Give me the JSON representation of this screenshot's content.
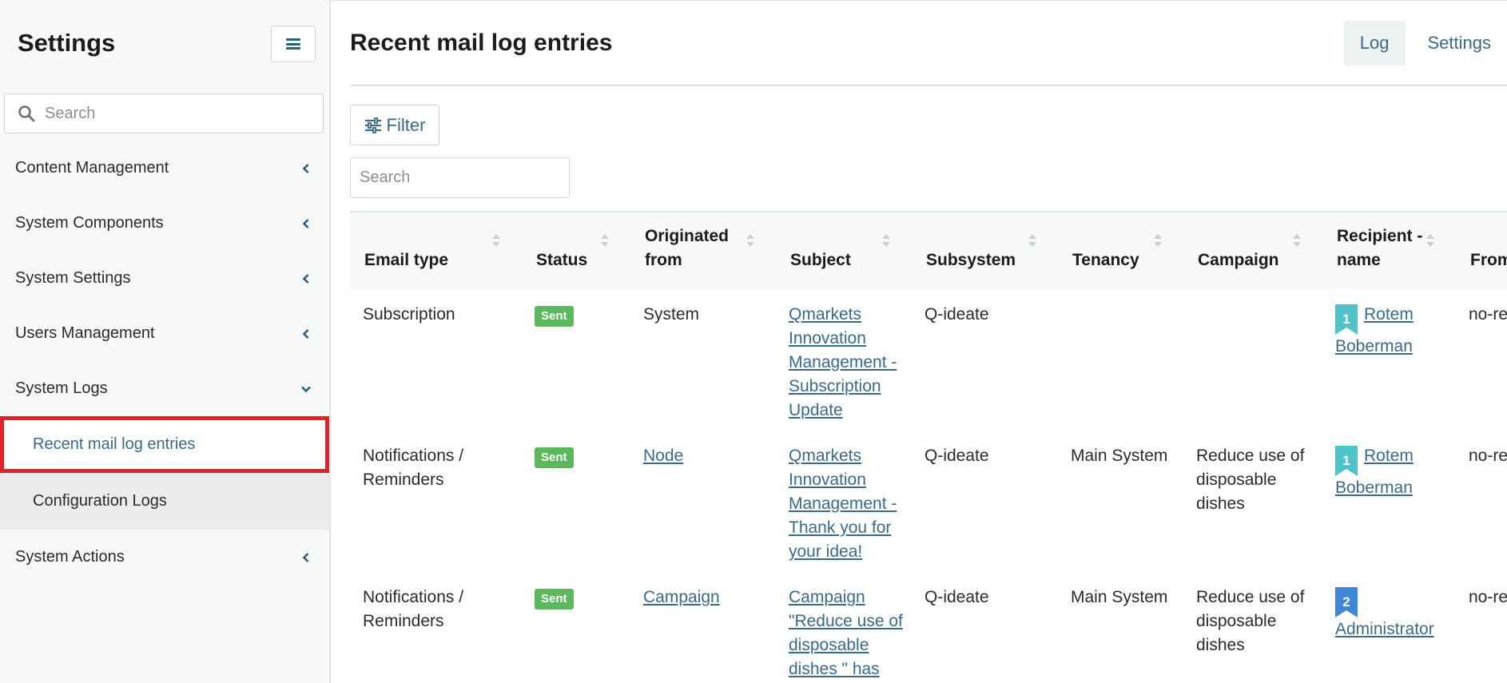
{
  "sidebar": {
    "title": "Settings",
    "search_placeholder": "Search",
    "items": [
      {
        "label": "Content Management"
      },
      {
        "label": "System Components"
      },
      {
        "label": "System Settings"
      },
      {
        "label": "Users Management"
      },
      {
        "label": "System Logs",
        "expanded": true,
        "children": [
          {
            "label": "Recent mail log entries",
            "active": true
          },
          {
            "label": "Configuration Logs"
          }
        ]
      },
      {
        "label": "System Actions"
      }
    ]
  },
  "header": {
    "title": "Recent mail log entries",
    "tabs": [
      {
        "label": "Log",
        "active": true
      },
      {
        "label": "Settings"
      }
    ]
  },
  "toolbar": {
    "filter_label": "Filter",
    "search_placeholder": "Search"
  },
  "table": {
    "columns": [
      "Email type",
      "Status",
      "Originated from",
      "Subject",
      "Subsystem",
      "Tenancy",
      "Campaign",
      "Recipient - name",
      "From email"
    ],
    "rows": [
      {
        "email_type": "Subscription",
        "status": "Sent",
        "origin": "System",
        "subject": "Qmarkets Innovation Management - Subscription Update",
        "subsystem": "Q-ideate",
        "tenancy": "",
        "campaign": "",
        "recipient_rank": "1",
        "recipient": "Rotem Boberman",
        "from": "no-repl"
      },
      {
        "email_type": "Notifications / Reminders",
        "status": "Sent",
        "origin": "Node",
        "subject": "Qmarkets Innovation Management - Thank you for your idea!",
        "subsystem": "Q-ideate",
        "tenancy": "Main System",
        "campaign": "Reduce use of disposable dishes",
        "recipient_rank": "1",
        "recipient": "Rotem Boberman",
        "from": "no-repl"
      },
      {
        "email_type": "Notifications / Reminders",
        "status": "Sent",
        "origin": "Campaign",
        "subject": "Campaign \"Reduce use of disposable dishes \" has",
        "subsystem": "Q-ideate",
        "tenancy": "Main System",
        "campaign": "Reduce use of disposable dishes",
        "recipient_rank": "2",
        "recipient": "Administrator",
        "from": "no-repl"
      }
    ]
  },
  "colors": {
    "accent": "#3b6a86",
    "sent_badge": "#5cb85c",
    "rank1": "#4fc3c9",
    "rank2": "#3f86d6",
    "highlight_border": "#e0232a"
  }
}
